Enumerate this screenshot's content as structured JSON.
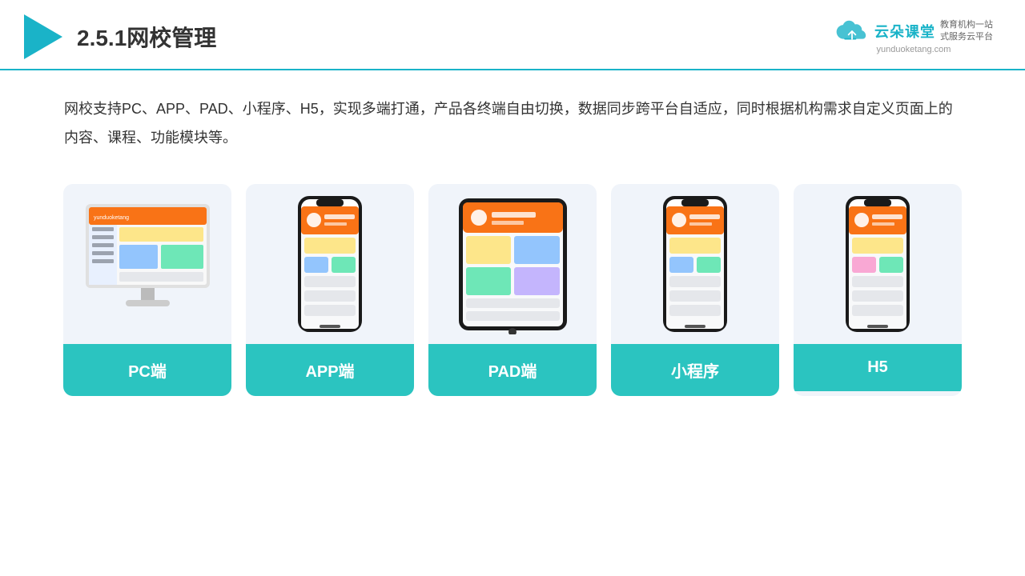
{
  "header": {
    "title": "2.5.1网校管理",
    "brand": {
      "name": "云朵课堂",
      "url": "yunduoketang.com",
      "slogan": "教育机构一站\n式服务云平台"
    }
  },
  "description": "网校支持PC、APP、PAD、小程序、H5，实现多端打通，产品各终端自由切换，数据同步跨平台自适应，同时根据机构需求自定义页面上的内容、课程、功能模块等。",
  "cards": [
    {
      "id": "pc",
      "label": "PC端",
      "device": "pc"
    },
    {
      "id": "app",
      "label": "APP端",
      "device": "phone"
    },
    {
      "id": "pad",
      "label": "PAD端",
      "device": "tablet"
    },
    {
      "id": "miniapp",
      "label": "小程序",
      "device": "mini-phone"
    },
    {
      "id": "h5",
      "label": "H5",
      "device": "mini-phone2"
    }
  ],
  "colors": {
    "accent": "#1ab3c8",
    "card_bg": "#f0f4fa",
    "card_label_bg": "#2bc4c0",
    "header_border": "#1ab3c8"
  }
}
